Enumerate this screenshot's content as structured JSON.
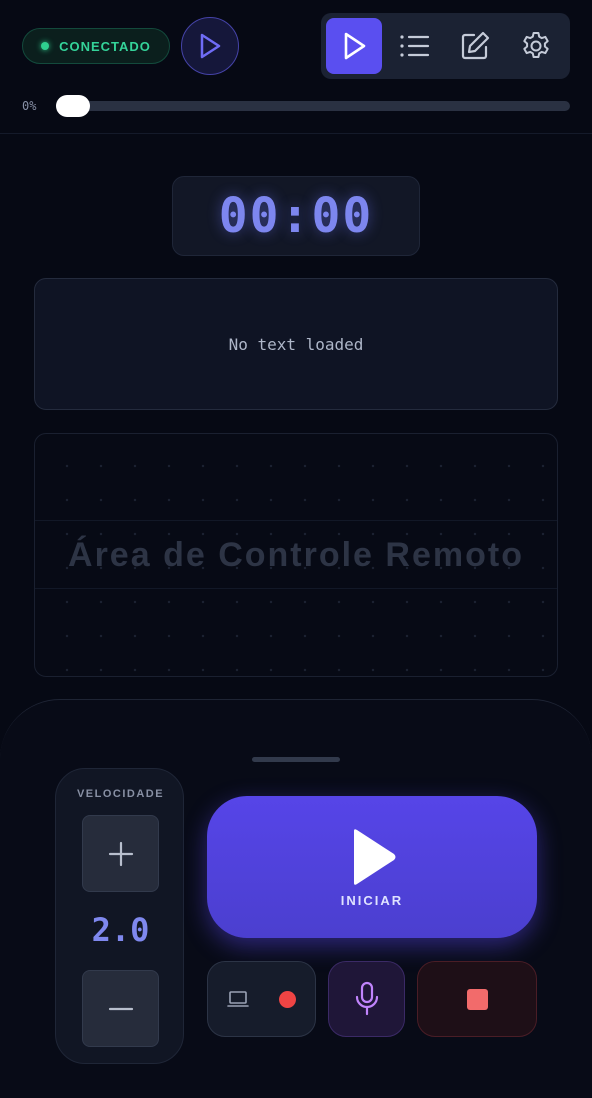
{
  "status": {
    "label": "CONECTADO",
    "color": "#34d399"
  },
  "header": {
    "play_icon": "play-icon",
    "modes": [
      {
        "icon": "play-icon",
        "active": true
      },
      {
        "icon": "list-icon",
        "active": false
      },
      {
        "icon": "edit-icon",
        "active": false
      },
      {
        "icon": "gear-icon",
        "active": false
      }
    ]
  },
  "progress": {
    "label": "0%",
    "value": 0
  },
  "timer": {
    "value": "00:00"
  },
  "script_area": {
    "text": "No text loaded"
  },
  "remote_area": {
    "label": "Área de Controle Remoto"
  },
  "speed": {
    "label": "VELOCIDADE",
    "value": "2.0",
    "increase_icon": "plus-icon",
    "decrease_icon": "minus-icon"
  },
  "start": {
    "label": "INICIAR",
    "icon": "play-icon",
    "color": "#5645e8"
  },
  "actions": {
    "cast_icon": "laptop-icon",
    "record_icon": "record-dot-icon",
    "mic_icon": "microphone-icon",
    "stop_icon": "stop-icon"
  },
  "colors": {
    "accent": "#5a4ff0",
    "timer": "#7d86ef",
    "record": "#ef4444",
    "mic": "#c084fc"
  }
}
